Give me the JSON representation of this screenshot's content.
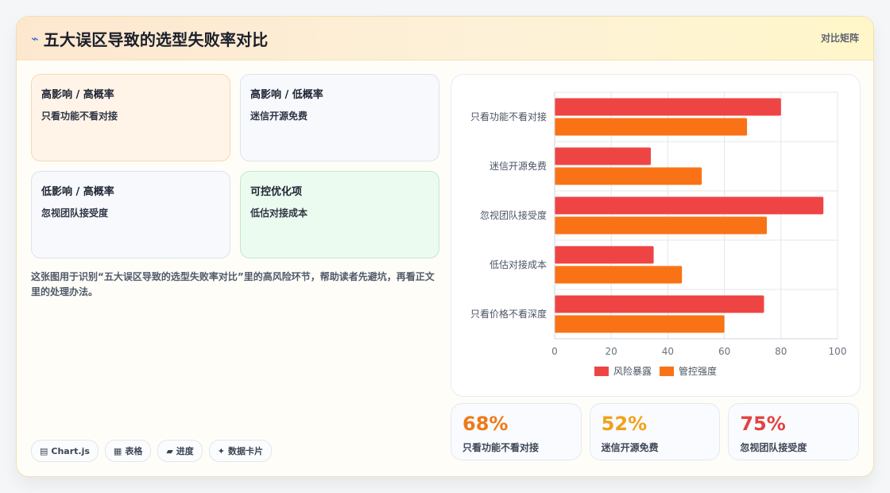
{
  "header": {
    "title": "五大误区导致的选型失败率对比",
    "right_label": "对比矩阵",
    "icon": "bolt-icon"
  },
  "matrix": {
    "cells": [
      {
        "heading": "高影响 / 高概率",
        "item": "只看功能不看对接",
        "tone": "orange"
      },
      {
        "heading": "高影响 / 低概率",
        "item": "迷信开源免费",
        "tone": "gray"
      },
      {
        "heading": "低影响 / 高概率",
        "item": "忽视团队接受度",
        "tone": "gray"
      },
      {
        "heading": "可控优化项",
        "item": "低估对接成本",
        "tone": "green"
      }
    ],
    "description": "这张图用于识别“五大误区导致的选型失败率对比”里的高风险环节，帮助读者先避坑，再看正文里的处理办法。"
  },
  "tags": [
    {
      "icon": "▤",
      "label": "Chart.js"
    },
    {
      "icon": "▦",
      "label": "表格"
    },
    {
      "icon": "▰",
      "label": "进度"
    },
    {
      "icon": "✦",
      "label": "数据卡片"
    }
  ],
  "stats": [
    {
      "value": "68%",
      "label": "只看功能不看对接",
      "color": "#ee7a1a"
    },
    {
      "value": "52%",
      "label": "迷信开源免费",
      "color": "#f0a21a"
    },
    {
      "value": "75%",
      "label": "忽视团队接受度",
      "color": "#e24343"
    }
  ],
  "chart_data": {
    "type": "bar",
    "orientation": "horizontal",
    "categories": [
      "只看功能不看对接",
      "迷信开源免费",
      "忽视团队接受度",
      "低估对接成本",
      "只看价格不看深度"
    ],
    "series": [
      {
        "name": "风险暴露",
        "values": [
          80,
          34,
          95,
          35,
          74
        ],
        "color": "#ef4444"
      },
      {
        "name": "管控强度",
        "values": [
          68,
          52,
          75,
          45,
          60
        ],
        "color": "#f97316"
      }
    ],
    "xlim": [
      0,
      100
    ],
    "xticks": [
      0,
      20,
      40,
      60,
      80,
      100
    ],
    "grid": true,
    "legend": "bottom"
  }
}
